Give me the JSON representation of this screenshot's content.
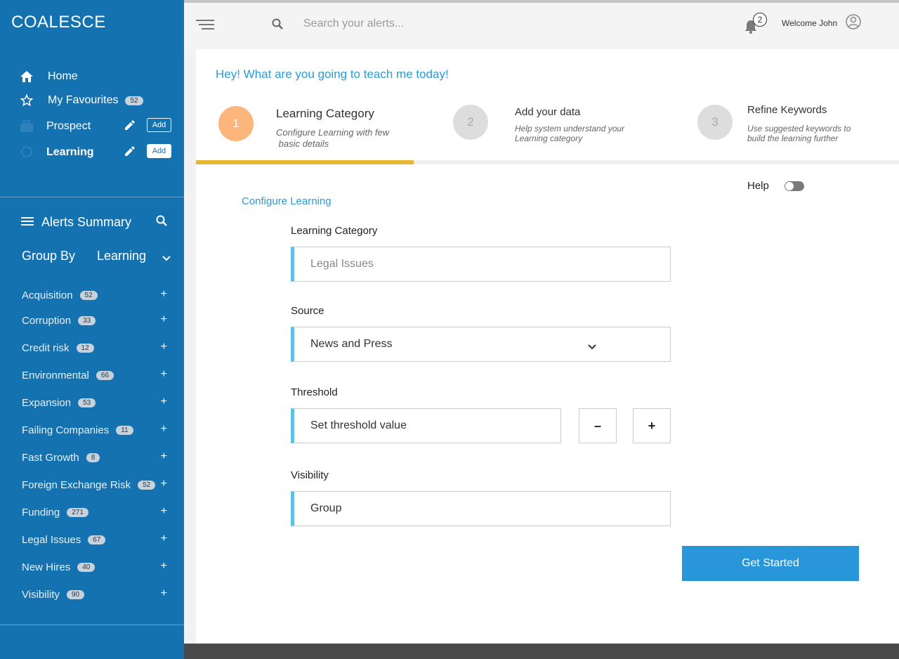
{
  "app": {
    "logo": "COALESCE"
  },
  "nav": {
    "home": "Home",
    "favourites": {
      "label": "My Favourites",
      "count": "52"
    },
    "prospect": {
      "label": "Prospect",
      "add": "Add"
    },
    "learning": {
      "label": "Learning",
      "add": "Add"
    }
  },
  "alerts": {
    "title": "Alerts Summary",
    "group_by_label": "Group By",
    "group_by_value": "Learning",
    "categories": [
      {
        "label": "Acquisition",
        "count": "52"
      },
      {
        "label": "Corruption",
        "count": "33"
      },
      {
        "label": "Credit risk",
        "count": "12"
      },
      {
        "label": "Environmental",
        "count": "66"
      },
      {
        "label": "Expansion",
        "count": "53"
      },
      {
        "label": "Failing Companies",
        "count": "11"
      },
      {
        "label": "Fast Growth",
        "count": "8"
      },
      {
        "label": "Foreign Exchange Risk",
        "count": "52"
      },
      {
        "label": "Funding",
        "count": "271"
      },
      {
        "label": "Legal Issues",
        "count": "67"
      },
      {
        "label": "New Hires",
        "count": "40"
      },
      {
        "label": "Visibility",
        "count": "90"
      }
    ],
    "plus": "+"
  },
  "topbar": {
    "search_placeholder": "Search your alerts...",
    "notifications": "2",
    "welcome": "Welcome John"
  },
  "wizard": {
    "headline": "Hey! What are you going to teach me today!",
    "steps": [
      {
        "num": "1",
        "title": "Learning Category",
        "desc1": "Configure Learning with few",
        "desc2": " basic details"
      },
      {
        "num": "2",
        "title": "Add your data",
        "desc1": "Help system understand your",
        "desc2": "Learning category"
      },
      {
        "num": "3",
        "title": "Refine Keywords",
        "desc1": "Use suggested keywords to",
        "desc2": "build the learning further"
      }
    ],
    "progress": 0.31,
    "colors": {
      "active_step": "#fcb57b",
      "inactive_step": "#dddddd",
      "progress": "#e6b836",
      "accent": "#2a9bd6",
      "sidebar": "#1472b0"
    }
  },
  "form": {
    "help_label": "Help",
    "section_title": "Configure Learning",
    "category_label": "Learning Category",
    "category_placeholder": "Legal Issues",
    "source_label": "Source",
    "source_value": "News and Press",
    "threshold_label": "Threshold",
    "threshold_placeholder": "Set threshold value",
    "minus": "–",
    "plus": "+",
    "visibility_label": "Visibility",
    "visibility_value": "Group",
    "submit": "Get Started"
  }
}
